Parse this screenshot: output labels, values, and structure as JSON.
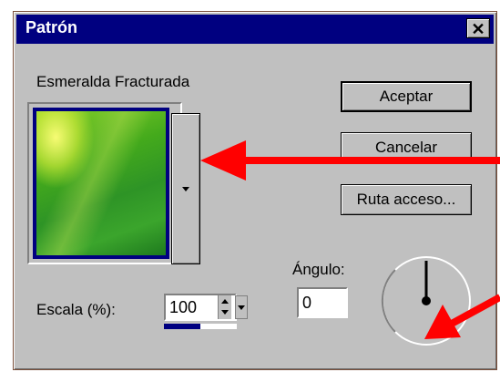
{
  "window": {
    "title": "Patrón",
    "close_label": "✕"
  },
  "pattern": {
    "name": "Esmeralda Fracturada"
  },
  "buttons": {
    "ok": "Aceptar",
    "cancel": "Cancelar",
    "path": "Ruta acceso..."
  },
  "scale": {
    "label": "Escala (%):",
    "value": "100",
    "level": 0.5
  },
  "angle": {
    "label": "Ángulo:",
    "value": "0",
    "degrees": 0
  },
  "colors": {
    "titlebar": "#000080",
    "arrow": "#ff0000"
  }
}
